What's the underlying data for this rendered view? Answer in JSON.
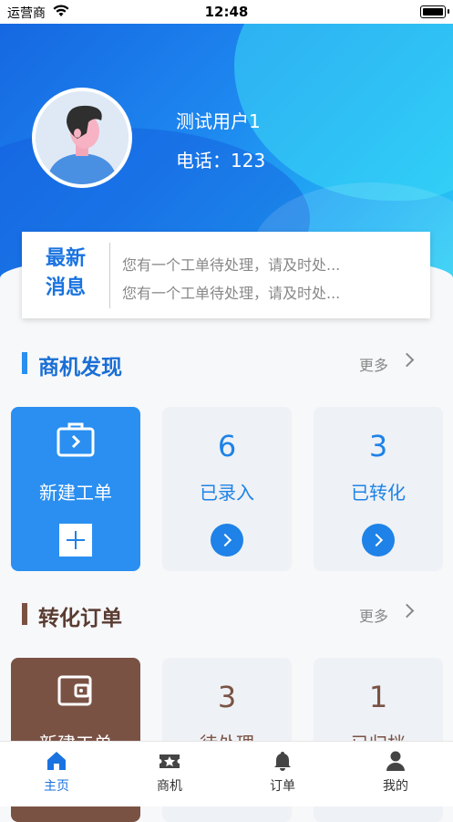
{
  "status_bar": {
    "carrier": "运营商",
    "time": "12:48"
  },
  "profile": {
    "name": "测试用户1",
    "phone": "电话：123"
  },
  "news": {
    "title_line1": "最新",
    "title_line2": "消息",
    "items": [
      "您有一个工单待处理，请及时处...",
      "您有一个工单待处理，请及时处..."
    ]
  },
  "opportunity": {
    "title": "商机发现",
    "more": "更多",
    "accent": "#2a8ff0",
    "new_label": "新建工单",
    "cards": [
      {
        "value": "6",
        "label": "已录入"
      },
      {
        "value": "3",
        "label": "已转化"
      }
    ]
  },
  "orders": {
    "title": "转化订单",
    "more": "更多",
    "accent": "#7a5244",
    "new_label": "新建工单",
    "cards": [
      {
        "value": "3",
        "label": "待处理"
      },
      {
        "value": "1",
        "label": "已归档"
      }
    ]
  },
  "tabbar": {
    "items": [
      {
        "label": "主页",
        "icon": "home-icon",
        "active": true
      },
      {
        "label": "商机",
        "icon": "ticket-star-icon",
        "active": false
      },
      {
        "label": "订单",
        "icon": "bell-icon",
        "active": false
      },
      {
        "label": "我的",
        "icon": "user-icon",
        "active": false
      }
    ],
    "active_color": "#1a73e0"
  }
}
